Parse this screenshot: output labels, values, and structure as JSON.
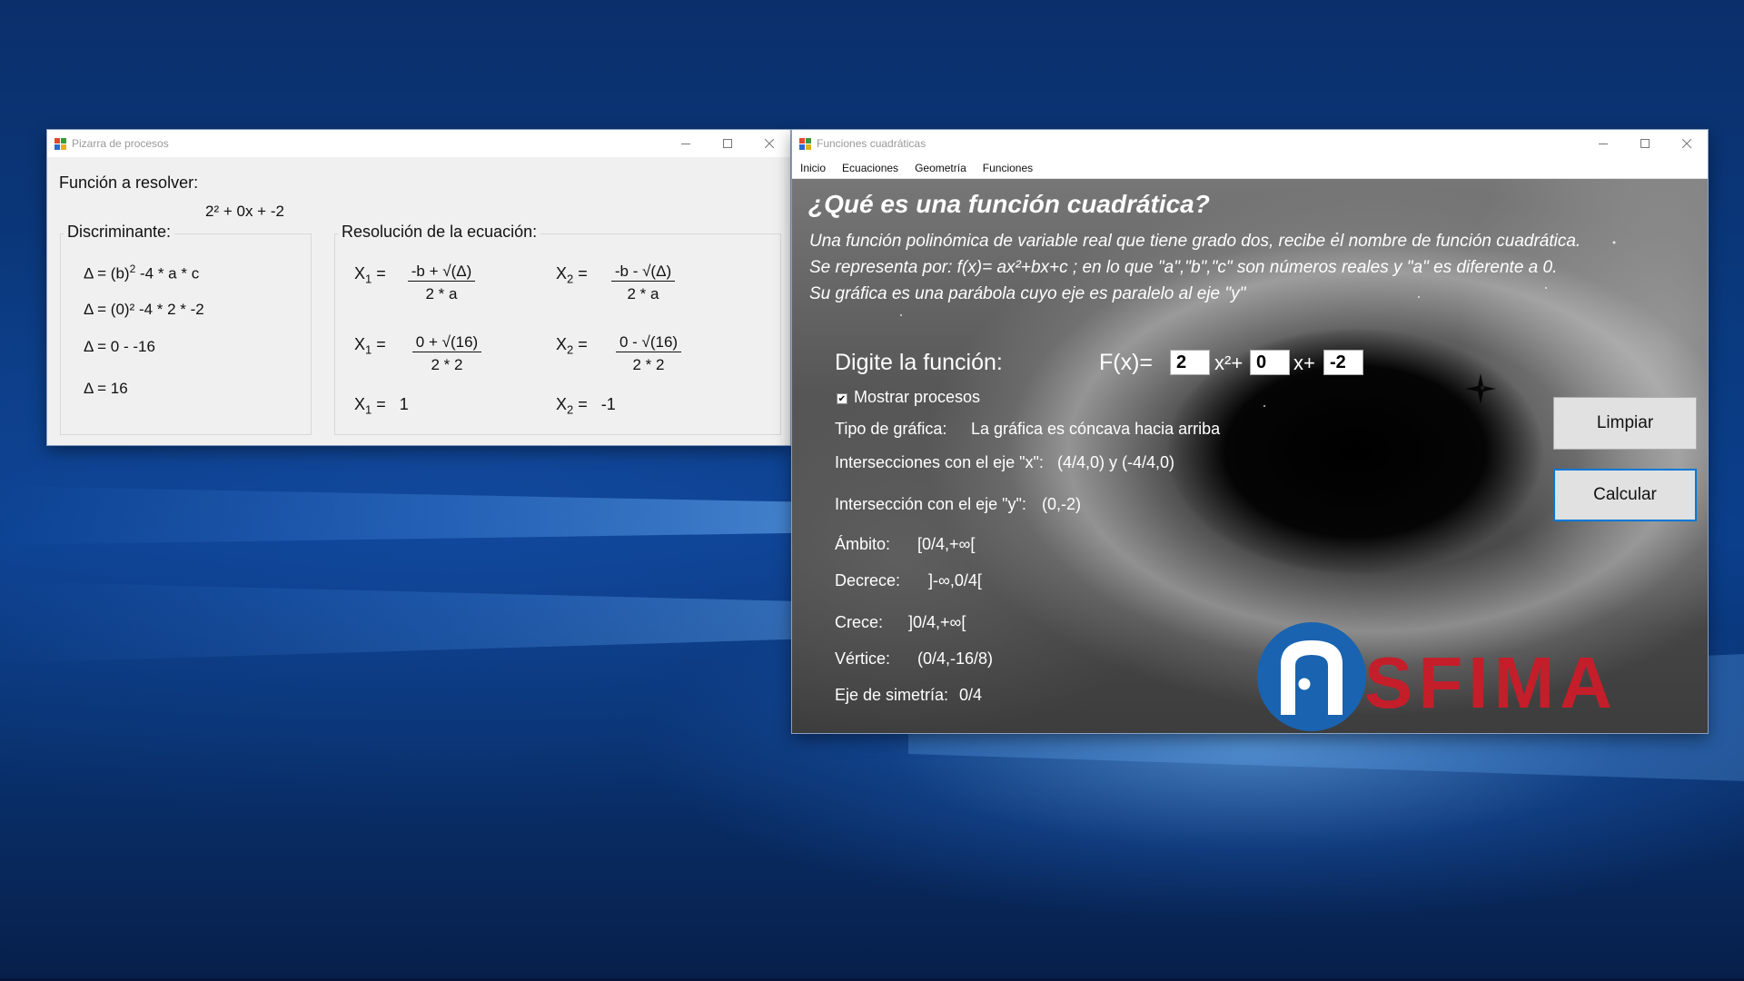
{
  "window_left": {
    "title": "Pizarra de procesos",
    "heading": "Función a resolver:",
    "function": "2² + 0x + -2",
    "discriminant": {
      "group_title": "Discriminante:",
      "line1_prefix": "Δ = (b)",
      "line1_sup": "2",
      "line1_suffix": "-4 * a * c",
      "line2": "Δ = (0)² -4 * 2 * -2",
      "line3": "Δ = 0 - -16",
      "line4": "Δ = 16"
    },
    "resolution": {
      "group_title": "Resolución de la ecuación:",
      "x1_label": "X",
      "x1_sub": "1",
      "x2_label": "X",
      "x2_sub": "2",
      "eq": "=",
      "x1_num_general": "-b + √(Δ)",
      "x1_den_general": "2 * a",
      "x2_num_general": "-b - √(Δ)",
      "x2_den_general": "2 * a",
      "x1_num": "0 + √(16)",
      "x1_den": "2 * 2",
      "x2_num": "0 - √(16)",
      "x2_den": "2 * 2",
      "x1_result": "1",
      "x2_result": "-1"
    }
  },
  "window_right": {
    "title": "Funciones cuadráticas",
    "menu": [
      "Inicio",
      "Ecuaciones",
      "Geometría",
      "Funciones"
    ],
    "heading": "¿Qué es una función cuadrática?",
    "description": [
      "Una función polinómica de variable real que tiene grado dos, recibe el nombre de función cuadrática.",
      "Se representa por: f(x)= ax²+bx+c ; en lo que \"a\",\"b\",\"c\" son números reales y \"a\" es diferente a 0.",
      "Su gráfica es una parábola cuyo eje es paralelo al eje \"y\""
    ],
    "input_label": "Digite la función:",
    "fx_label": "F(x)=",
    "a_value": "2",
    "x2_label": "x²+",
    "b_value": "0",
    "x_label": "x+",
    "c_value": "-2",
    "checkbox_label": "Mostrar procesos",
    "checkbox_checked": true,
    "results": {
      "tipo_label": "Tipo de gráfica:",
      "tipo_value": "La gráfica es cóncava hacia arriba",
      "intx_label": "Intersecciones con el eje \"x\":",
      "intx_value": "(4/4,0) y (-4/4,0)",
      "inty_label": "Intersección con el eje \"y\":",
      "inty_value": "(0,-2)",
      "ambito_label": "Ámbito:",
      "ambito_value": "[0/4,+∞[",
      "decrece_label": "Decrece:",
      "decrece_value": "]-∞,0/4[",
      "crece_label": "Crece:",
      "crece_value": "]0/4,+∞[",
      "vertice_label": "Vértice:",
      "vertice_value": "(0/4,-16/8)",
      "eje_label": "Eje de simetría:",
      "eje_value": "0/4"
    },
    "btn_limpiar": "Limpiar",
    "btn_calcular": "Calcular",
    "logo_text": "SFIMA",
    "logo_color": "#c41e2a",
    "logo_circle_color": "#1a63b0"
  }
}
